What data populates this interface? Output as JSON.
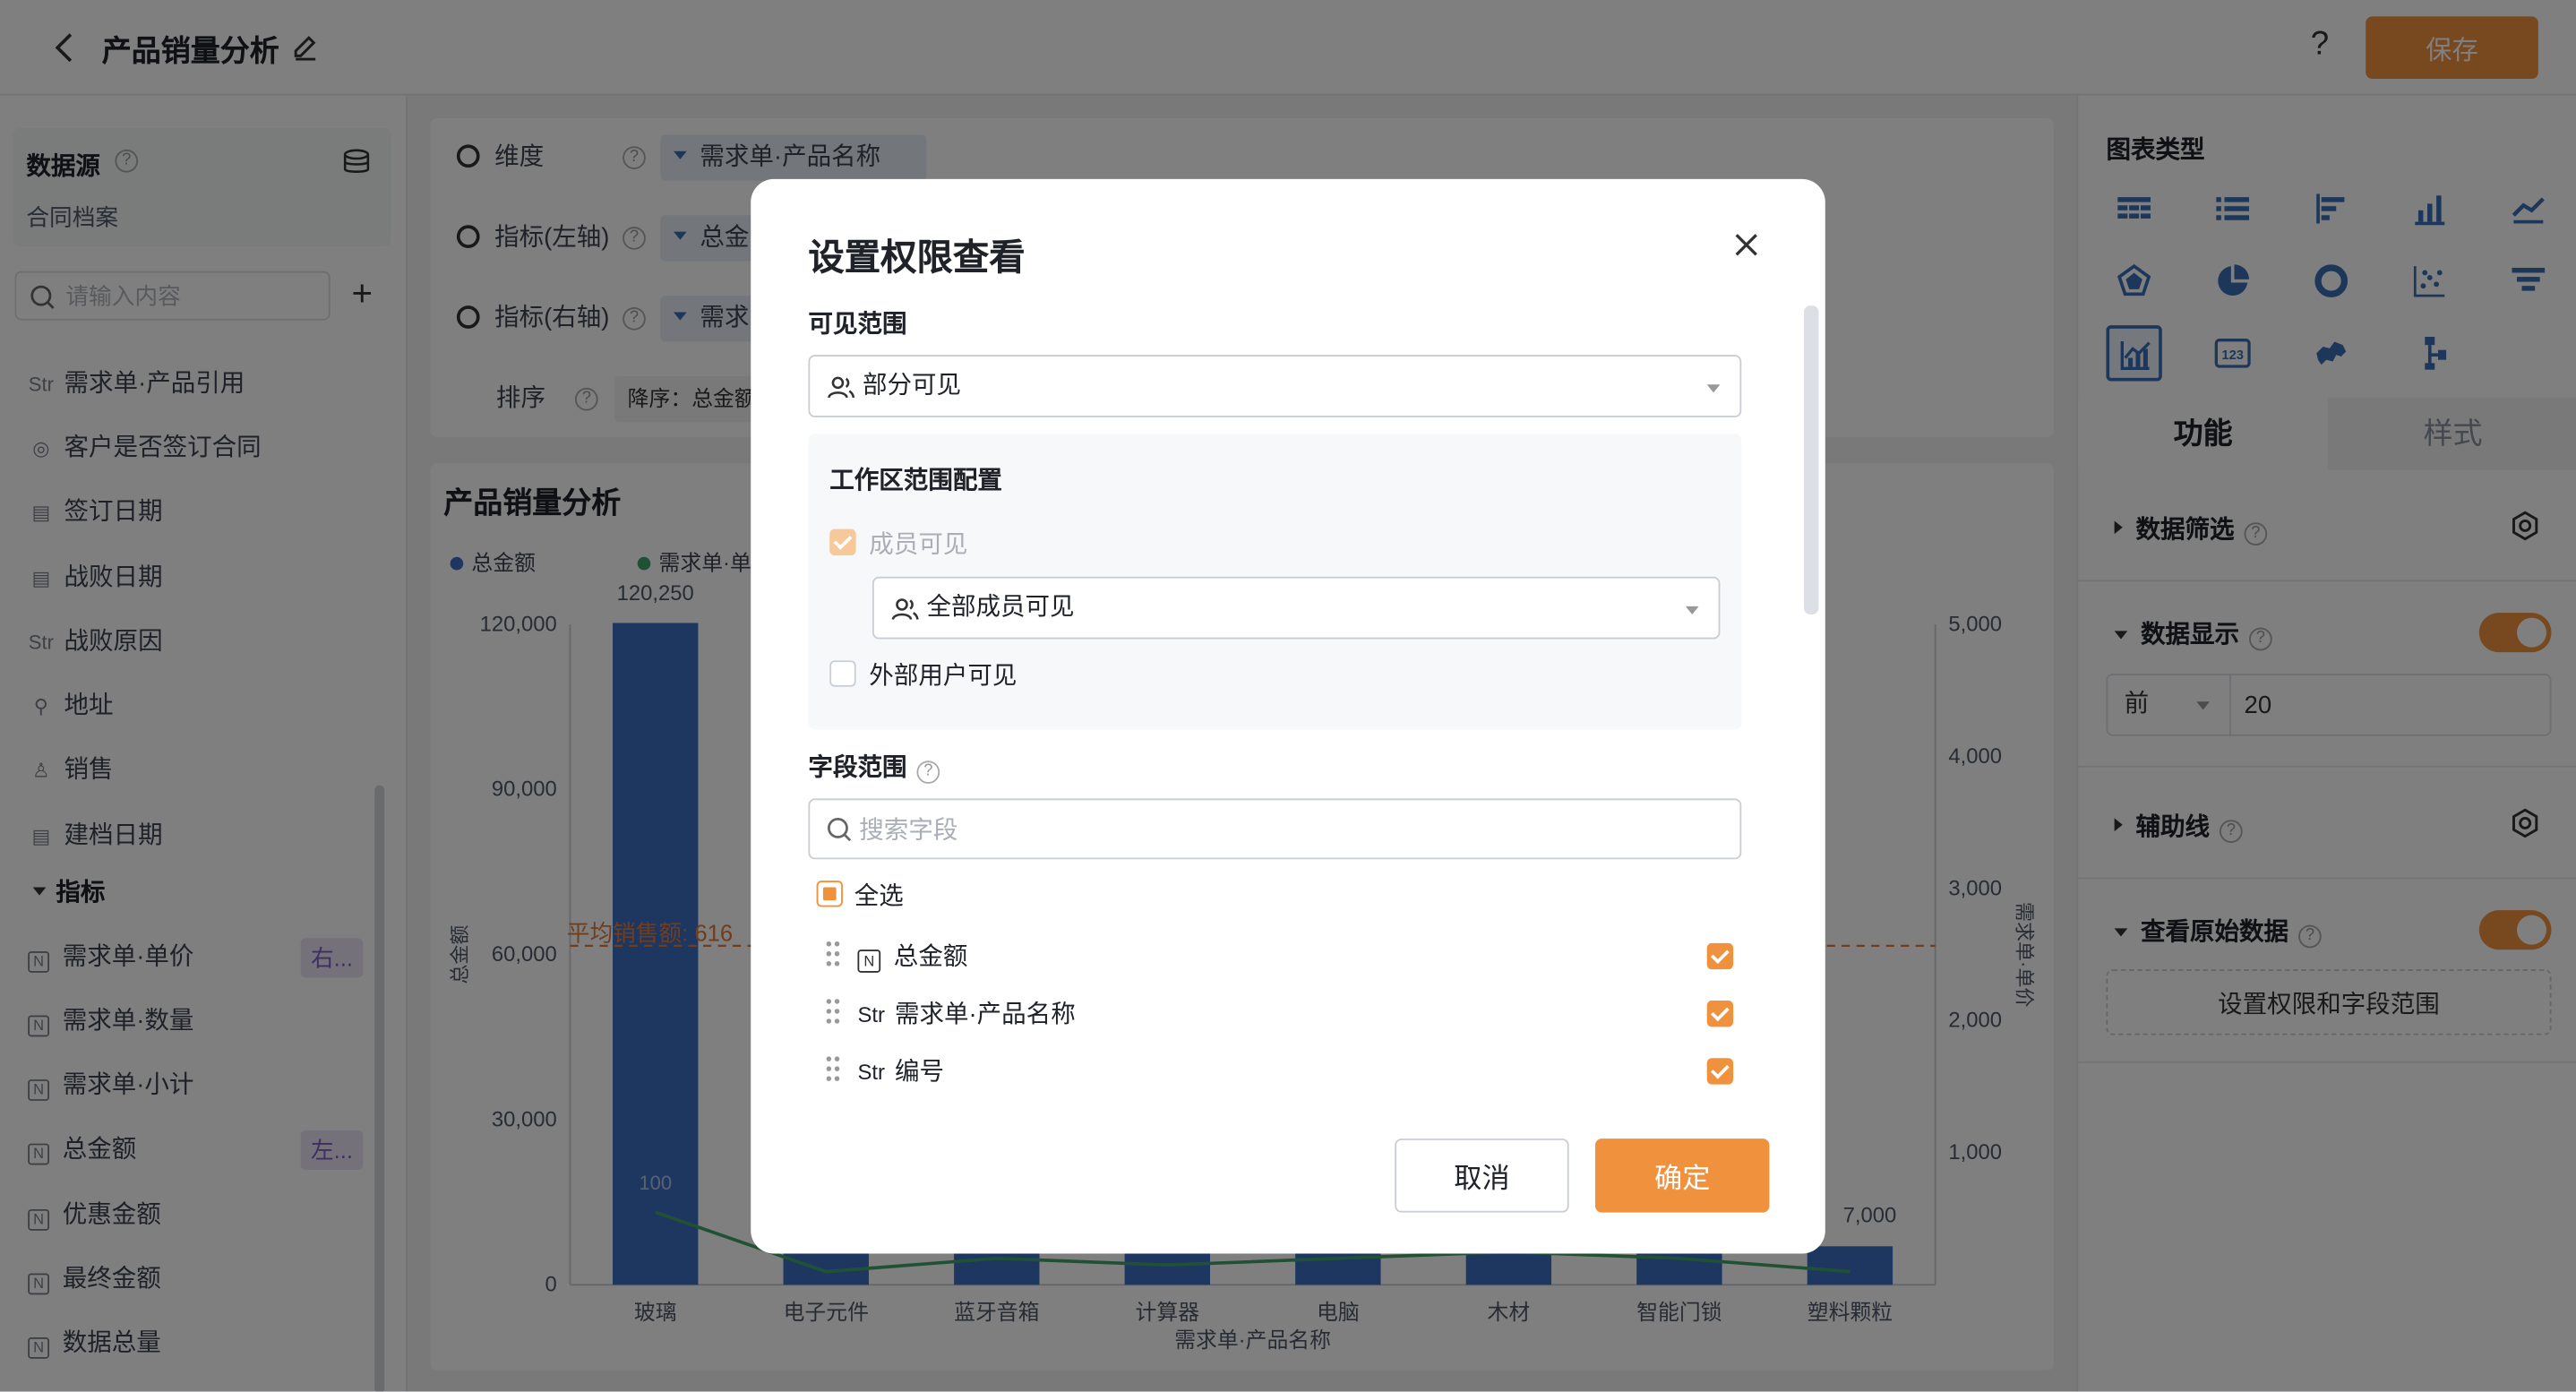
{
  "header": {
    "title": "产品销量分析",
    "help_label": "?",
    "save_label": "保存"
  },
  "left_panel": {
    "datasource_label": "数据源",
    "datasource_name": "合同档案",
    "search_placeholder": "请输入内容",
    "add_label": "+",
    "dimension_fields": [
      {
        "type": "Str",
        "name": "需求单·产品引用"
      },
      {
        "type": "radio",
        "name": "客户是否签订合同"
      },
      {
        "type": "date",
        "name": "签订日期"
      },
      {
        "type": "date",
        "name": "战败日期"
      },
      {
        "type": "Str",
        "name": "战败原因"
      },
      {
        "type": "addr",
        "name": "地址"
      },
      {
        "type": "user",
        "name": "销售"
      },
      {
        "type": "date",
        "name": "建档日期"
      }
    ],
    "metrics_label": "指标",
    "metric_fields": [
      {
        "type": "N",
        "name": "需求单·单价",
        "tag": "右..."
      },
      {
        "type": "N",
        "name": "需求单·数量",
        "tag": ""
      },
      {
        "type": "N",
        "name": "需求单·小计",
        "tag": ""
      },
      {
        "type": "N",
        "name": "总金额",
        "tag": "左..."
      },
      {
        "type": "N",
        "name": "优惠金额",
        "tag": ""
      },
      {
        "type": "N",
        "name": "最终金额",
        "tag": ""
      },
      {
        "type": "N",
        "name": "数据总量",
        "tag": ""
      }
    ]
  },
  "config": {
    "dimension_label": "维度",
    "dimension_value": "需求单·产品名称",
    "left_axis_label": "指标(左轴)",
    "left_axis_value": "总金",
    "right_axis_label": "指标(右轴)",
    "right_axis_value": "需求",
    "sort_label": "排序",
    "sort_value": "降序：总金额"
  },
  "chart": {
    "title": "产品销量分析",
    "legend": [
      "总金额",
      "需求单·单"
    ],
    "colors": {
      "bar": "#3a6fc0",
      "line": "#43a36b",
      "avg": "#e07a3a"
    },
    "avg_label": "平均销售额: 616",
    "top_label": "120,250",
    "right_label_near_last": "7,000",
    "bar_inner_label": "100"
  },
  "chart_data": {
    "type": "bar",
    "title": "产品销量分析",
    "xlabel": "需求单·产品名称",
    "ylabel": "总金额",
    "y2label": "需求单·单价",
    "categories": [
      "玻璃",
      "电子元件",
      "蓝牙音箱",
      "计算器",
      "电脑",
      "木材",
      "智能门锁",
      "塑料颗粒"
    ],
    "ylim": [
      0,
      120000
    ],
    "yticks": [
      "0",
      "30,000",
      "60,000",
      "90,000",
      "120,000"
    ],
    "y2lim": [
      0,
      5000
    ],
    "y2ticks": [
      "1,000",
      "2,000",
      "3,000",
      "4,000",
      "5,000"
    ],
    "series": [
      {
        "name": "总金额",
        "type": "bar",
        "values": [
          120250,
          6000,
          6000,
          6000,
          6000,
          6000,
          6000,
          7000
        ]
      },
      {
        "name": "需求单·单",
        "type": "line",
        "axis": "right",
        "values": [
          550,
          100,
          200,
          150,
          200,
          250,
          200,
          100
        ]
      }
    ],
    "avg_line": {
      "label": "平均销售额: 616",
      "value": 61600
    }
  },
  "right_panel": {
    "chart_type_label": "图表类型",
    "tab_function": "功能",
    "tab_style": "样式",
    "filter_label": "数据筛选",
    "display_label": "数据显示",
    "topn_select": "前",
    "topn_value": "20",
    "aux_label": "辅助线",
    "raw_label": "查看原始数据",
    "perm_button": "设置权限和字段范围",
    "display_on": true,
    "raw_on": true
  },
  "modal": {
    "title": "设置权限查看",
    "visible_scope_label": "可见范围",
    "visible_scope_value": "部分可见",
    "workspace_label": "工作区范围配置",
    "member_visible_label": "成员可见",
    "member_scope_value": "全部成员可见",
    "external_label": "外部用户可见",
    "field_scope_label": "字段范围",
    "field_search_placeholder": "搜索字段",
    "select_all_label": "全选",
    "fields": [
      {
        "type": "N",
        "name": "总金额",
        "checked": true
      },
      {
        "type": "Str",
        "name": "需求单·产品名称",
        "checked": true
      },
      {
        "type": "Str",
        "name": "编号",
        "checked": true
      }
    ],
    "cancel_label": "取消",
    "ok_label": "确定"
  }
}
